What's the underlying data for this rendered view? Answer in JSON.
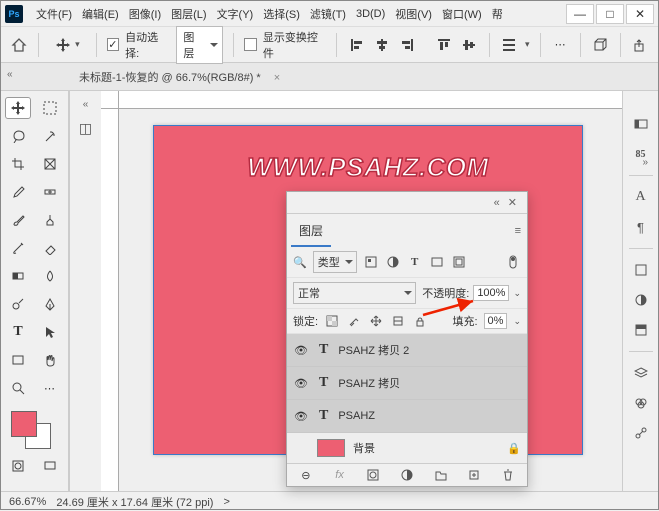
{
  "app": {
    "logo": "Ps"
  },
  "menus": [
    "文件(F)",
    "编辑(E)",
    "图像(I)",
    "图层(L)",
    "文字(Y)",
    "选择(S)",
    "滤镜(T)",
    "3D(D)",
    "视图(V)",
    "窗口(W)",
    "帮"
  ],
  "win_controls": {
    "min": "—",
    "max": "□",
    "close": "✕"
  },
  "options_bar": {
    "auto_select_label": "自动选择:",
    "target_dropdown": "图层",
    "show_transform_label": "显示变换控件"
  },
  "document_tab": {
    "label": "未标题-1-恢复的 @ 66.7%(RGB/8#) *",
    "close": "×"
  },
  "canvas": {
    "watermark": "WWW.PSAHZ.COM"
  },
  "layers_panel": {
    "title": "图层",
    "type_label": "类型",
    "search_icon": "🔍",
    "blend_mode": "正常",
    "opacity_label": "不透明度:",
    "opacity_value": "100%",
    "lock_label": "锁定:",
    "fill_label": "填充:",
    "fill_value": "0%",
    "layers": [
      {
        "name": "PSAHZ 拷贝 2",
        "type": "T"
      },
      {
        "name": "PSAHZ 拷贝",
        "type": "T"
      },
      {
        "name": "PSAHZ",
        "type": "T"
      }
    ],
    "bg_label": "背景",
    "footer_icons": [
      "⊖",
      "fx",
      "◐",
      "◧",
      "▭",
      "⊕",
      "🗑"
    ]
  },
  "right_dock": [
    "✥",
    "85",
    "A",
    "¶",
    "□",
    "✶",
    "◳",
    "◧",
    "⊙",
    "◉",
    "≣",
    "◧"
  ],
  "left_panel_icon": "◫",
  "statusbar": {
    "zoom": "66.67%",
    "dims": "24.69 厘米 x 17.64 厘米 (72 ppi)",
    "more": ">"
  },
  "tools": {
    "row_top": "⟷"
  }
}
